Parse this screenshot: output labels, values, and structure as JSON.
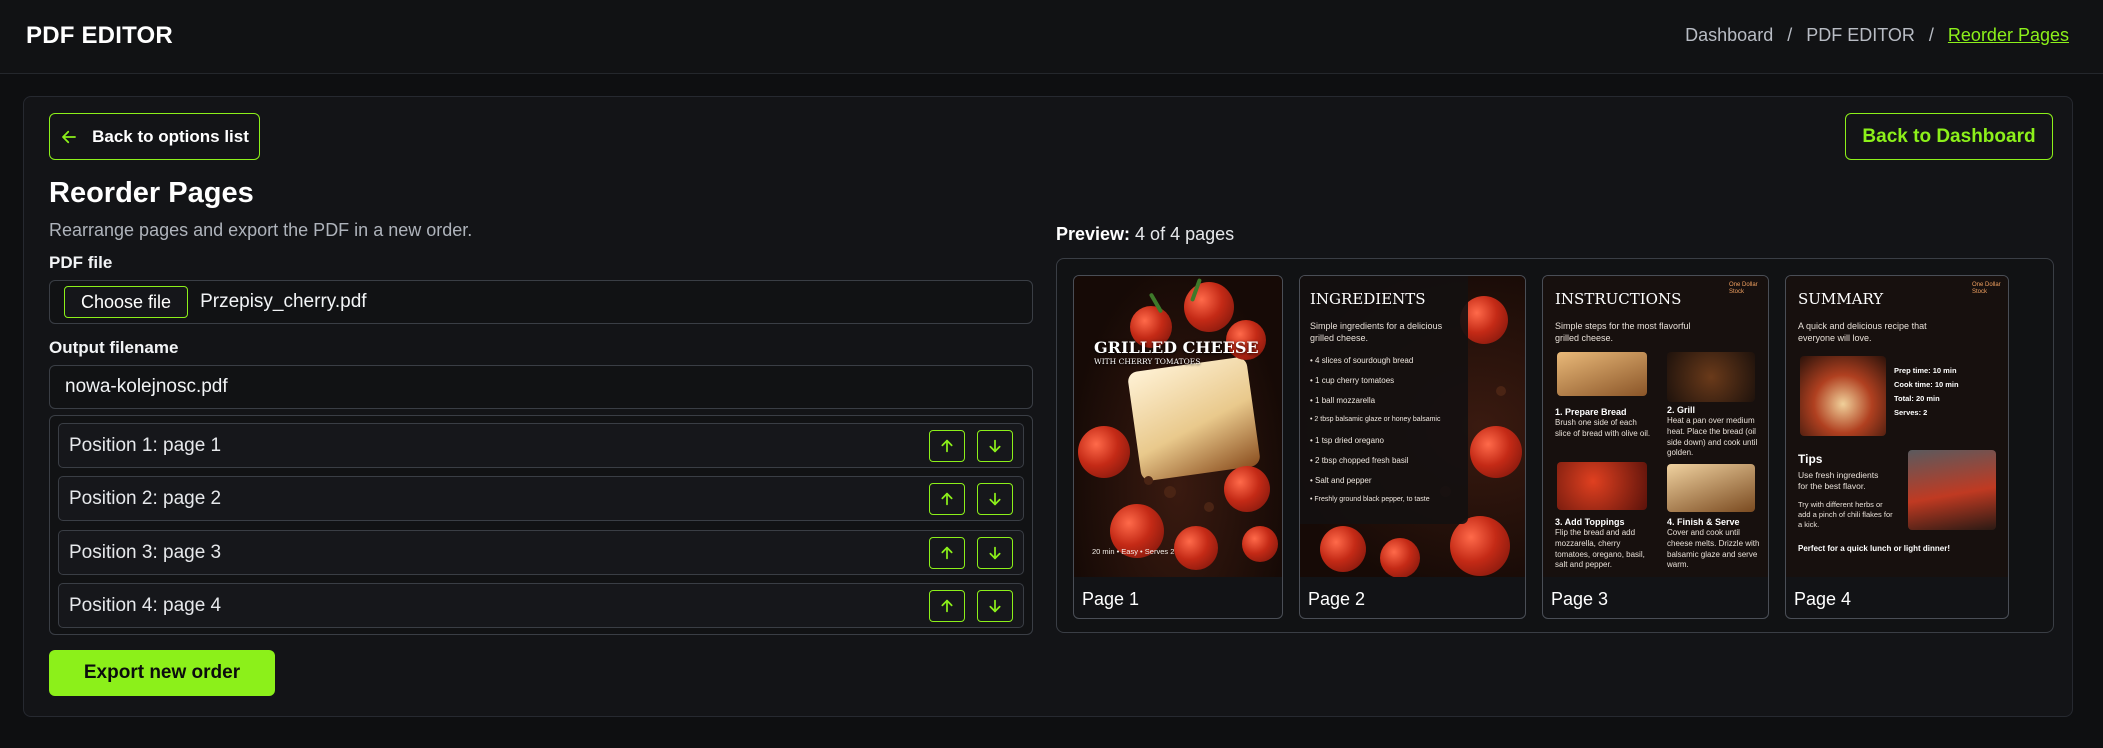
{
  "header": {
    "app_title": "PDF EDITOR",
    "breadcrumb": [
      "Dashboard",
      "PDF EDITOR",
      "Reorder Pages"
    ]
  },
  "toolbar": {
    "back_options_label": "Back to options list",
    "back_dashboard_label": "Back to Dashboard"
  },
  "main": {
    "title": "Reorder Pages",
    "description": "Rearrange pages and export the PDF in a new order.",
    "pdf_file_label": "PDF file",
    "choose_file_label": "Choose file",
    "file_name": "Przepisy_cherry.pdf",
    "output_label": "Output filename",
    "output_value": "nowa-kolejnosc.pdf",
    "positions": [
      {
        "label": "Position 1: page 1"
      },
      {
        "label": "Position 2: page 2"
      },
      {
        "label": "Position 3: page 3"
      },
      {
        "label": "Position 4: page 4"
      }
    ],
    "export_label": "Export new order"
  },
  "preview": {
    "label_bold": "Preview:",
    "label_rest": " 4 of 4 pages",
    "pages": [
      {
        "caption": "Page 1"
      },
      {
        "caption": "Page 2"
      },
      {
        "caption": "Page 3"
      },
      {
        "caption": "Page 4"
      }
    ]
  },
  "page_contents": {
    "p1": {
      "title": "GRILLED CHEESE",
      "subtitle": "WITH CHERRY TOMATOES",
      "footer": "20 min  •  Easy  •  Serves 2"
    },
    "p2": {
      "title": "INGREDIENTS",
      "intro": "Simple ingredients for a delicious grilled cheese.",
      "items": [
        "4 slices of sourdough bread",
        "1 cup cherry tomatoes",
        "1 ball mozzarella",
        "2 tbsp balsamic glaze or honey balsamic",
        "1 tsp dried oregano",
        "2 tbsp chopped fresh basil",
        "Salt and pepper",
        "Freshly ground black pepper, to taste"
      ]
    },
    "p3": {
      "title": "INSTRUCTIONS",
      "intro": "Simple steps for the most flavorful grilled cheese.",
      "logo": "One Dollar Stock",
      "steps": [
        {
          "h": "1. Prepare Bread",
          "t": "Brush one side of each slice of bread with olive oil."
        },
        {
          "h": "2. Grill",
          "t": "Heat a pan over medium heat. Place the bread (oil side down) and cook until golden."
        },
        {
          "h": "3. Add Toppings",
          "t": "Flip the bread and add mozzarella, cherry tomatoes, oregano, basil, salt and pepper."
        },
        {
          "h": "4. Finish & Serve",
          "t": "Cover and cook until cheese melts. Drizzle with balsamic glaze and serve warm."
        }
      ]
    },
    "p4": {
      "title": "SUMMARY",
      "intro": "A quick and delicious recipe that everyone will love.",
      "logo": "One Dollar Stock",
      "facts": [
        "Prep time: 10 min",
        "Cook time: 10 min",
        "Total: 20 min",
        "Serves: 2"
      ],
      "tips_title": "Tips",
      "tips": "Use fresh ingredients for the best flavor.",
      "tips2": "Try with different herbs or add a pinch of chili flakes for a kick.",
      "closing": "Perfect for a quick lunch or light dinner!"
    }
  },
  "colors": {
    "accent": "#8cf01a",
    "background": "#0e0f11",
    "card": "#131417",
    "border": "#3a3e45"
  },
  "icons": {
    "back": "arrow-left-icon",
    "up": "arrow-up-icon",
    "down": "arrow-down-icon"
  }
}
